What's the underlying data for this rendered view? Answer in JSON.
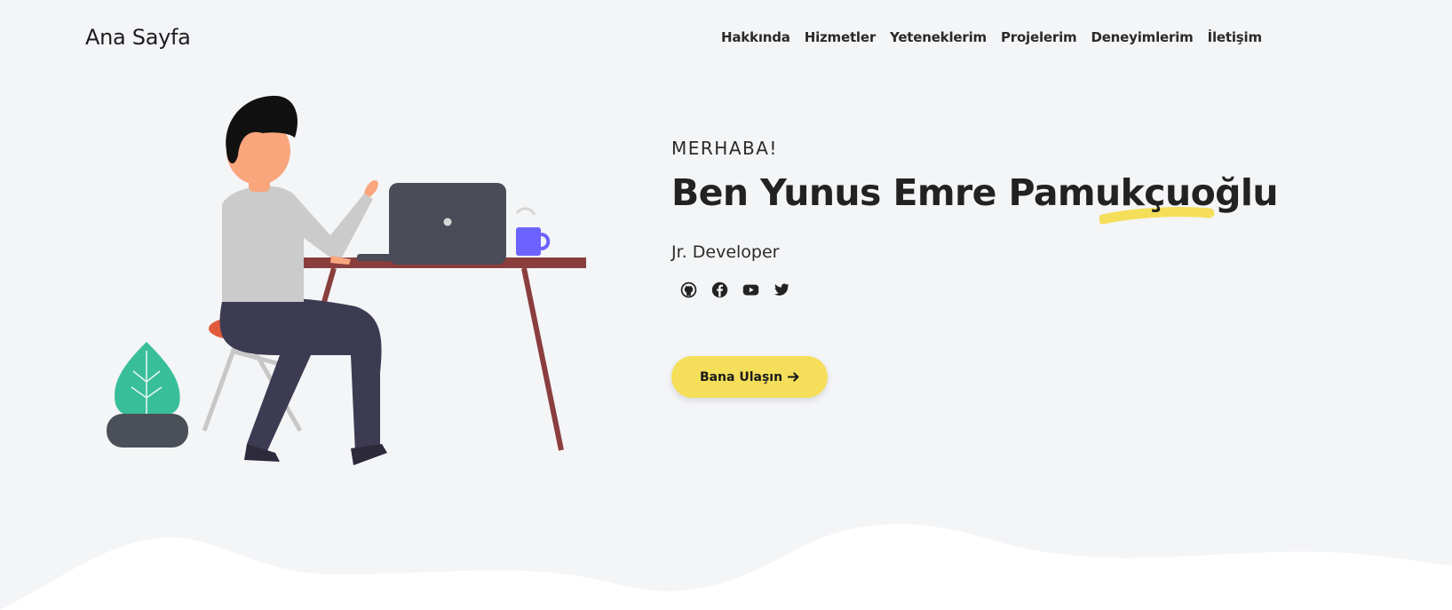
{
  "header": {
    "logo": "Ana Sayfa",
    "nav": [
      "Hakkında",
      "Hizmetler",
      "Yeteneklerim",
      "Projelerim",
      "Deneyimlerim",
      "İletişim"
    ]
  },
  "hero": {
    "greeting": "MERHABA!",
    "name": "Ben Yunus Emre Pamukçuoğlu",
    "role": "Jr. Developer",
    "cta_label": "Bana Ulaşın",
    "cta_icon": "arrow-right-icon",
    "socials": [
      {
        "icon": "github-icon"
      },
      {
        "icon": "facebook-icon"
      },
      {
        "icon": "youtube-icon"
      },
      {
        "icon": "twitter-icon"
      }
    ]
  },
  "colors": {
    "background": "#f4f5f7",
    "accent": "#f5df5a",
    "wave": "#ffffff"
  }
}
